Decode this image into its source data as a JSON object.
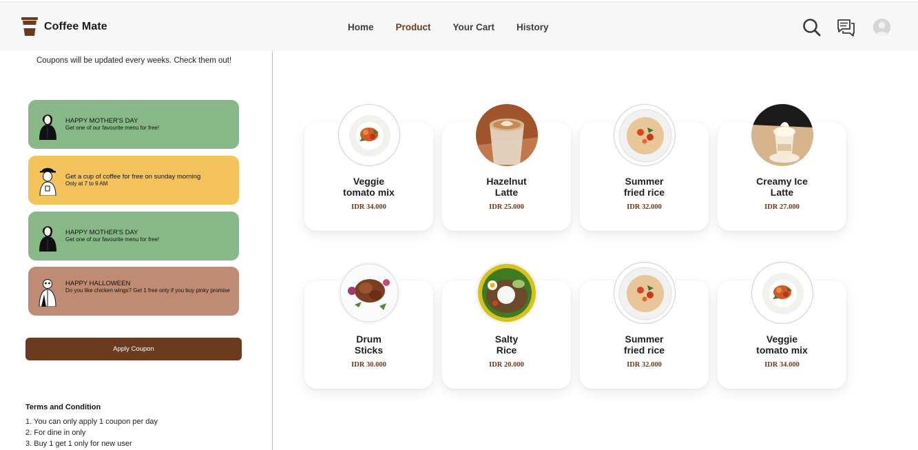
{
  "app": {
    "name": "Coffee Mate"
  },
  "nav": {
    "items": [
      "Home",
      "Product",
      "Your Cart",
      "History"
    ],
    "active": "Product"
  },
  "header_icons": [
    "search-icon",
    "chat-icon",
    "avatar"
  ],
  "coupons": {
    "note": "Coupons will be updated every weeks. Check them out!",
    "items": [
      {
        "title": "HAPPY MOTHER'S DAY",
        "subtitle": "Get one of our favourite menu for free!",
        "color": "#88b888"
      },
      {
        "title": "Get a cup of coffee for free on sunday morning",
        "subtitle": "Only at 7 to 9 AM",
        "color": "#f5c35b"
      },
      {
        "title": "HAPPY MOTHER'S DAY",
        "subtitle": "Get one of our favourite menu for free!",
        "color": "#88b888"
      },
      {
        "title": "HAPPY HALLOWEEN",
        "subtitle": "Do you like chicken wings? Get 1 free only if you buy pinky promise",
        "color": "#c08b73"
      }
    ],
    "apply_label": "Apply Coupon"
  },
  "terms": {
    "title": "Terms and Condition",
    "items": [
      "1. You can only apply 1 coupon per day",
      "2. For dine in only",
      "3. Buy 1 get 1 only for new user"
    ]
  },
  "products": [
    {
      "name_line1": "Veggie",
      "name_line2": "tomato mix",
      "price": "IDR 34.000",
      "image": "veggie-tomato-mix"
    },
    {
      "name_line1": "Hazelnut",
      "name_line2": "Latte",
      "price": "IDR 25.000",
      "image": "hazelnut-latte"
    },
    {
      "name_line1": "Summer",
      "name_line2": "fried rice",
      "price": "IDR 32.000",
      "image": "summer-fried-rice"
    },
    {
      "name_line1": "Creamy Ice",
      "name_line2": "Latte",
      "price": "IDR 27.000",
      "image": "creamy-ice-latte"
    },
    {
      "name_line1": "Drum",
      "name_line2": "Sticks",
      "price": "IDR 30.000",
      "image": "drum-sticks"
    },
    {
      "name_line1": "Salty",
      "name_line2": "Rice",
      "price": "IDR 20.000",
      "image": "salty-rice"
    },
    {
      "name_line1": "Summer",
      "name_line2": "fried rice",
      "price": "IDR 32.000",
      "image": "summer-fried-rice"
    },
    {
      "name_line1": "Veggie",
      "name_line2": "tomato mix",
      "price": "IDR 34.000",
      "image": "veggie-tomato-mix"
    }
  ],
  "colors": {
    "brand": "#6b3a1f",
    "header_bg": "#f7f7f7",
    "green_coupon": "#88b888",
    "yellow_coupon": "#f5c35b",
    "brown_coupon": "#c08b73"
  }
}
